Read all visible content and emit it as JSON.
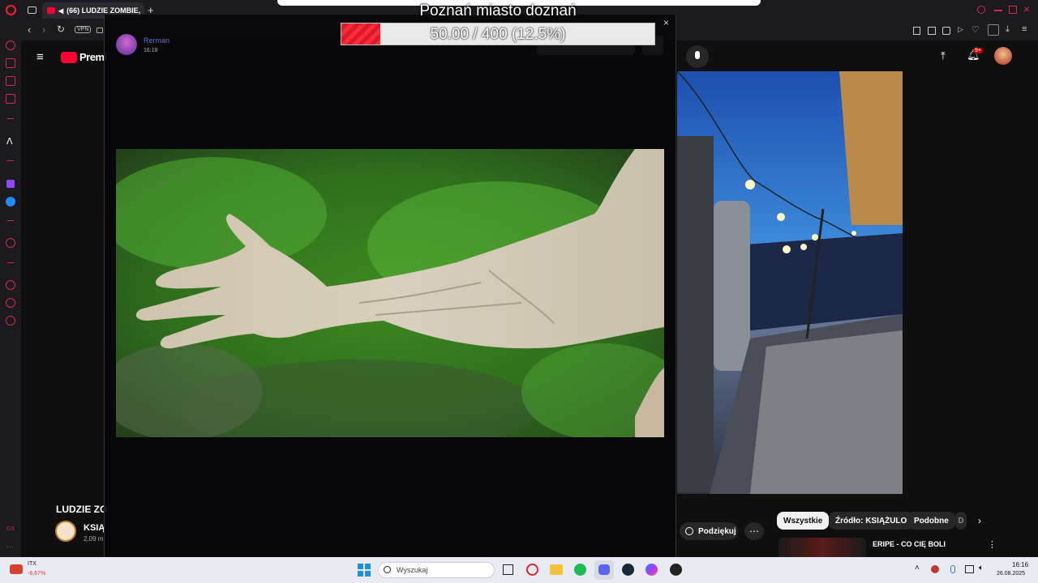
{
  "browser": {
    "tab_title": "(66) LUDZIE ZOMBIE,",
    "new_tab": "+",
    "vpn_label": "VPN"
  },
  "lightbox": {
    "author": "Rerman",
    "time": "16:18",
    "close": "×"
  },
  "overlay": {
    "title": "Poznań miasto doznań",
    "progress_text": "50.00 / 400 (12.5%)",
    "progress_fraction": 0.125,
    "progress_color": "#ff2a3a"
  },
  "youtube": {
    "logo_text": "Premi",
    "notification_badge": "9+",
    "video_title": "LUDZIE ZO",
    "channel_name": "KSIĄ",
    "subscribers": "2,09 m",
    "thanks_button": "Podziękuj",
    "more_button": "⋯",
    "chips": [
      "Wszystkie",
      "Źródło: KSIĄŻULO",
      "Podobne",
      "D"
    ],
    "recommended_title": "ERIPE - CO CIĘ BOLI",
    "accent_color": "#ff0033"
  },
  "taskbar": {
    "weather_label": "ITX",
    "weather_value": "-6,67%",
    "search_placeholder": "Wyszukaj",
    "time": "16:16",
    "date": "26.08.2025"
  }
}
